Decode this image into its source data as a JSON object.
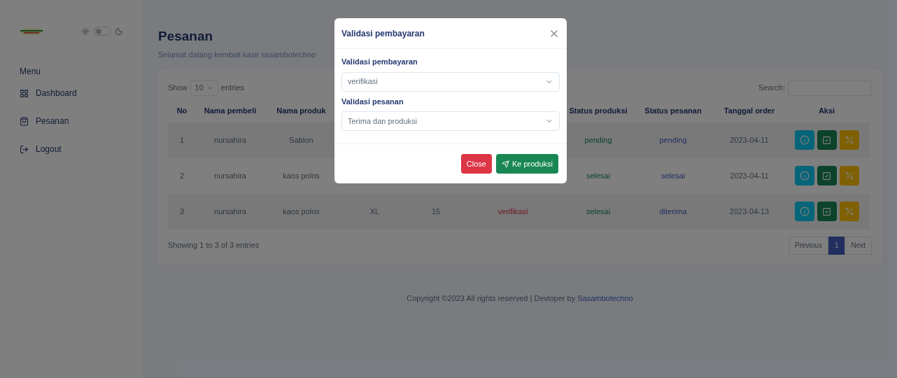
{
  "sidebar": {
    "theme_toggle": {
      "on": false
    },
    "menu_title": "Menu",
    "items": [
      {
        "label": "Dashboard",
        "kind": "grid"
      },
      {
        "label": "Pesanan",
        "kind": "bag"
      },
      {
        "label": "Logout",
        "kind": "logout"
      }
    ]
  },
  "header": {
    "title": "Pesanan",
    "subtitle": "Selamat datang kembali kasir sasambotechno"
  },
  "table": {
    "show_label": "Show",
    "page_size": "10",
    "entries_label": "entries",
    "search_label": "Search:",
    "columns": [
      {
        "label": "No"
      },
      {
        "label": "Nama pembeli"
      },
      {
        "label": "Nama produk"
      },
      null,
      null,
      null,
      {
        "label": "Status produksi"
      },
      {
        "label": "Status pesanan"
      },
      {
        "label": "Tanggal order"
      },
      {
        "label": "Aksi"
      }
    ],
    "rows": [
      {
        "cells": [
          "1",
          "nursahira",
          "Sablon",
          null,
          null,
          null,
          "pending",
          "pending",
          "2023-04-11"
        ]
      },
      {
        "cells": [
          "2",
          "nursahira",
          "kaos polos",
          null,
          null,
          null,
          "selesai",
          "selesai",
          "2023-04-11"
        ]
      },
      {
        "cells": [
          "3",
          "nursahira",
          "kaos polos",
          "XL",
          "15",
          "verifikasi",
          "selesai",
          "diterima",
          "2023-04-13"
        ]
      }
    ],
    "row_actions": [
      {
        "kind": "info"
      },
      {
        "kind": "check"
      },
      {
        "kind": "percent"
      }
    ],
    "info": "Showing 1 to 3 of 3 entries",
    "pagination": [
      {
        "label": "Previous",
        "selected": false
      },
      {
        "label": "1",
        "selected": true
      },
      {
        "label": "Next",
        "selected": false
      }
    ]
  },
  "footer": {
    "text": "Copyright ©2023 All rights reserved | Devloper by",
    "link": "Sasambotechno"
  },
  "modal": {
    "title": "Validasi pembayaran",
    "fields": [
      {
        "label": "Validasi pembayaran",
        "value": "verifikasi"
      },
      {
        "label": "Validasi pesanan",
        "value": "Terima dan produksi"
      }
    ],
    "buttons": [
      {
        "label": "Close",
        "kind": "danger"
      },
      {
        "label": "Ke produksi",
        "kind": "send"
      }
    ]
  }
}
